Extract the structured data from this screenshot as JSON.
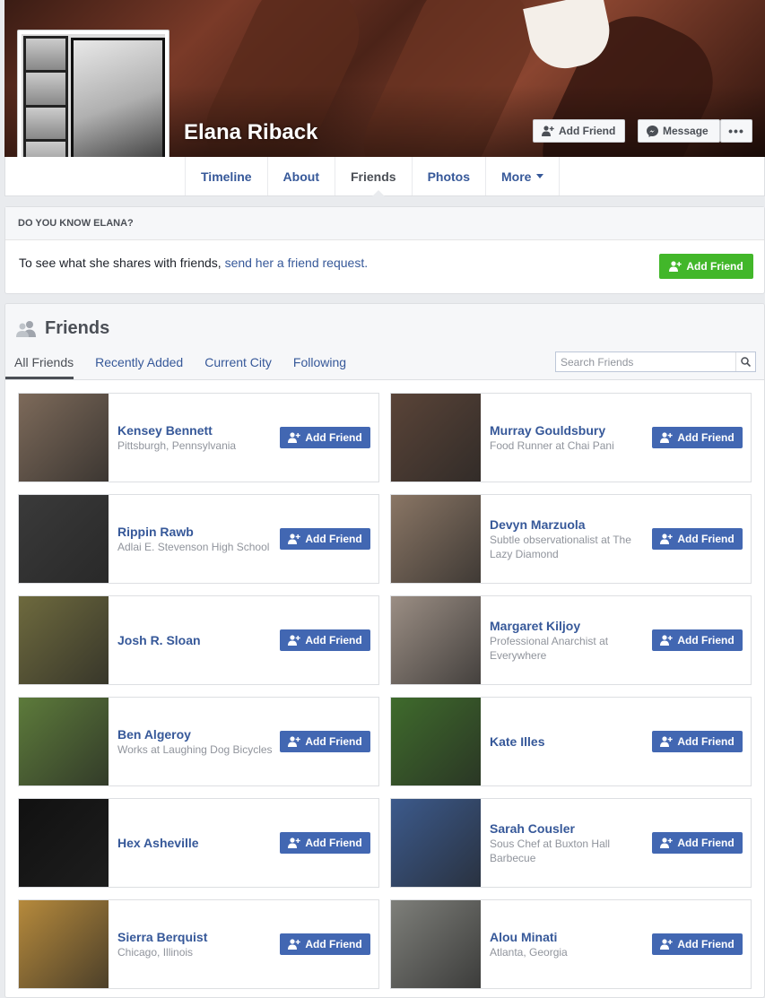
{
  "profile": {
    "name": "Elana Riback",
    "add_friend_label": "Add Friend",
    "message_label": "Message",
    "more_icon": "ellipsis-icon"
  },
  "nav": {
    "tabs": [
      {
        "label": "Timeline"
      },
      {
        "label": "About"
      },
      {
        "label": "Friends"
      },
      {
        "label": "Photos"
      },
      {
        "label": "More"
      }
    ],
    "active": "Friends"
  },
  "know": {
    "heading": "DO YOU KNOW ELANA?",
    "text": "To see what she shares with friends, ",
    "link": "send her a friend request.",
    "button": "Add Friend"
  },
  "friends": {
    "title": "Friends",
    "tabs": [
      {
        "label": "All Friends"
      },
      {
        "label": "Recently Added"
      },
      {
        "label": "Current City"
      },
      {
        "label": "Following"
      }
    ],
    "search_placeholder": "Search Friends",
    "button_label": "Add Friend",
    "list": [
      {
        "name": "Kensey Bennett",
        "sub": "Pittsburgh, Pennsylvania",
        "color": "#7d6a5a"
      },
      {
        "name": "Murray Gouldsbury",
        "sub_pre": "Food Runner at ",
        "sub_link": "Chai Pani",
        "color": "#5a4438"
      },
      {
        "name": "Rippin Rawb",
        "sub": "Adlai E. Stevenson High School",
        "color": "#3a3a3a"
      },
      {
        "name": "Devyn Marzuola",
        "sub_pre": "Subtle observationalist at ",
        "sub_link": "The Lazy Diamond",
        "color": "#8a7665"
      },
      {
        "name": "Josh R. Sloan",
        "sub": "",
        "color": "#6e6a3e"
      },
      {
        "name": "Margaret Kiljoy",
        "sub_pre": "Professional Anarchist at ",
        "sub_link": "Everywhere",
        "color": "#9b8e84"
      },
      {
        "name": "Ben Algeroy",
        "sub_pre": "Works at ",
        "sub_link": "Laughing Dog Bicycles",
        "color": "#5d7b3b"
      },
      {
        "name": "Kate Illes",
        "sub": "",
        "color": "#3f6b2c"
      },
      {
        "name": "Hex Asheville",
        "sub": "",
        "color": "#111111"
      },
      {
        "name": "Sarah Cousler",
        "sub_pre": "Sous Chef at ",
        "sub_link": "Buxton Hall Barbecue",
        "color": "#3c5a8c"
      },
      {
        "name": "Sierra Berquist",
        "sub": "Chicago, Illinois",
        "color": "#b68a3c"
      },
      {
        "name": "Alou Minati",
        "sub": "Atlanta, Georgia",
        "color": "#7e7f7a"
      }
    ]
  }
}
